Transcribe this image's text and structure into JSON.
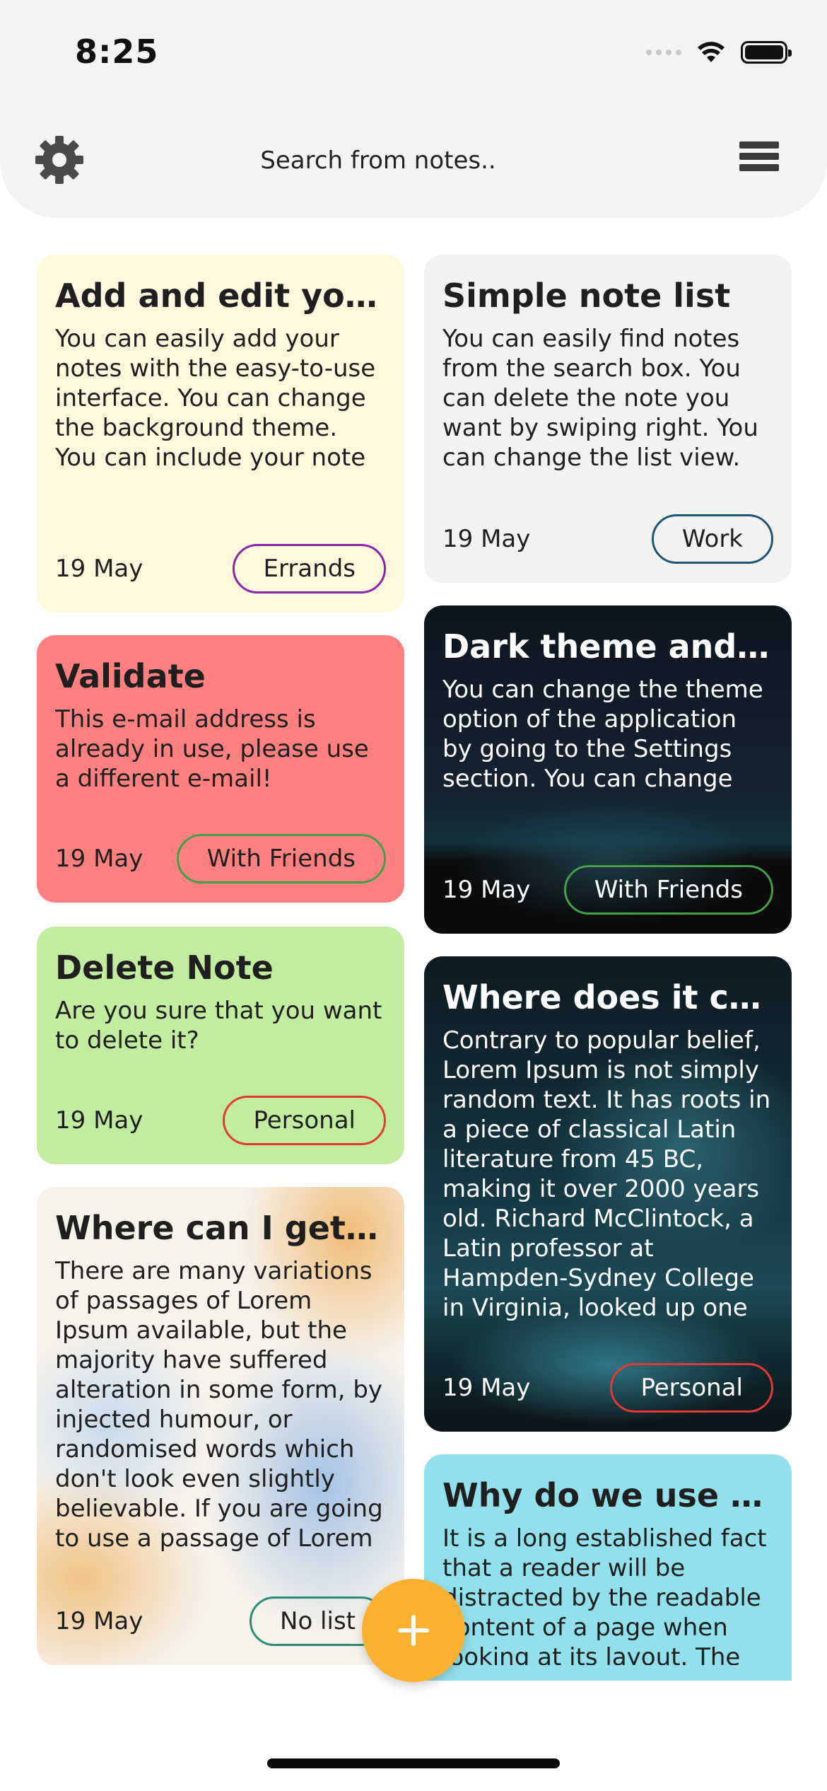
{
  "status_bar": {
    "time": "8:25",
    "icons": [
      "signal-icon",
      "wifi-icon",
      "battery-icon"
    ]
  },
  "header": {
    "settings_icon": "gear-icon",
    "search_placeholder": "Search from notes..",
    "menu_icon": "hamburger-menu-icon"
  },
  "notes": [
    {
      "title": "Add and edit your notes",
      "body": "You can easily add your notes with the easy-to-use interface. You can change the background theme. You can include your note in the category.",
      "date": "19 May",
      "tag": "Errands",
      "tag_color": "#8e24aa",
      "background": "#fdf9dd"
    },
    {
      "title": "Simple note list",
      "body": "You can easily find notes from the search box. You can delete the note you want by swiping right. You can change the list view.",
      "date": "19 May",
      "tag": "Work",
      "tag_color": "#1f5674",
      "background": "#f2f2f3"
    },
    {
      "title": "Validate",
      "body": "This e-mail address is already in use, please use a different e-mail!",
      "date": "19 May",
      "tag": "With Friends",
      "tag_color": "#43a047",
      "background": "#fe8080"
    },
    {
      "title": "Dark theme and language",
      "body": "You can change the theme option of the application by going to the Settings section. You can change the application language",
      "date": "19 May",
      "tag": "With Friends",
      "tag_color": "#43a047",
      "background": "night-sky-image"
    },
    {
      "title": "Delete Note",
      "body": "Are you sure that you want to delete it?",
      "date": "19 May",
      "tag": "Personal",
      "tag_color": "#e53935",
      "background": "#c2eda0"
    },
    {
      "title": "Where does it come from?",
      "body": "Contrary to popular belief, Lorem Ipsum is not simply random text. It has roots in a piece of classical Latin literature from 45 BC, making it over 2000 years old. Richard McClintock, a Latin professor at Hampden-Sydney College in Virginia, looked up one of the more obscure Latin words",
      "date": "19 May",
      "tag": "Personal",
      "tag_color": "#e53935",
      "background": "starry-ocean-image"
    },
    {
      "title": "Where can I get some?",
      "body": "There are many variations of passages of Lorem Ipsum available, but the majority have suffered alteration in some form, by injected humour, or randomised words which don't look even slightly believable. If you are going to use a passage of Lorem Ipsum",
      "date": "19 May",
      "tag": "No list",
      "tag_color": "#2e8b7a",
      "background": "watercolor-image"
    },
    {
      "title": "Why do we use it?",
      "body": "It is a long established fact that a reader will be distracted by the readable content of a page when looking at its layout. The",
      "background": "#92e0ec"
    }
  ],
  "fab": {
    "icon": "plus-icon"
  }
}
